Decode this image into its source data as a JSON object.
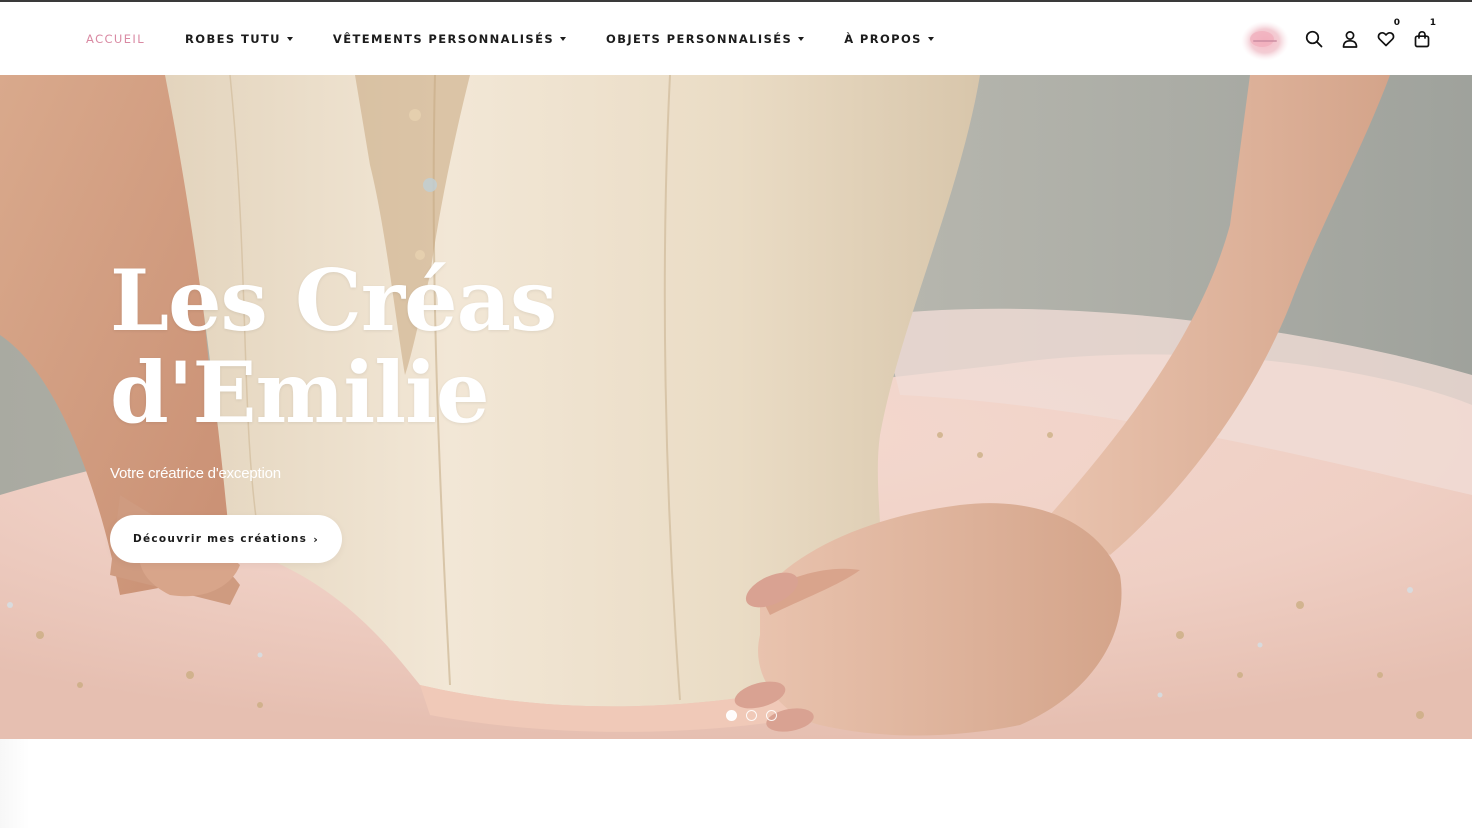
{
  "nav": {
    "items": [
      {
        "label": "ACCUEIL",
        "active": true,
        "dropdown": false
      },
      {
        "label": "ROBES TUTU",
        "active": false,
        "dropdown": true
      },
      {
        "label": "VÊTEMENTS PERSONNALISÉS",
        "active": false,
        "dropdown": true
      },
      {
        "label": "OBJETS PERSONNALISÉS",
        "active": false,
        "dropdown": true
      },
      {
        "label": "À PROPOS",
        "active": false,
        "dropdown": true
      }
    ]
  },
  "header_icons": {
    "search": "search-icon",
    "account": "user-icon",
    "wishlist": "heart-icon",
    "wishlist_count": "0",
    "cart": "shopping-bag-icon",
    "cart_count": "1"
  },
  "hero": {
    "title_line1": "Les Créas",
    "title_line2": "d'Emilie",
    "subtitle": "Votre créatrice d'exception",
    "cta_label": "Découvrir mes créations",
    "cta_chevron": "›",
    "slides_total": 3,
    "slide_active": 1
  },
  "colors": {
    "accent": "#d98aa3",
    "text": "#1c1c1c",
    "hero_text": "#ffffff"
  }
}
